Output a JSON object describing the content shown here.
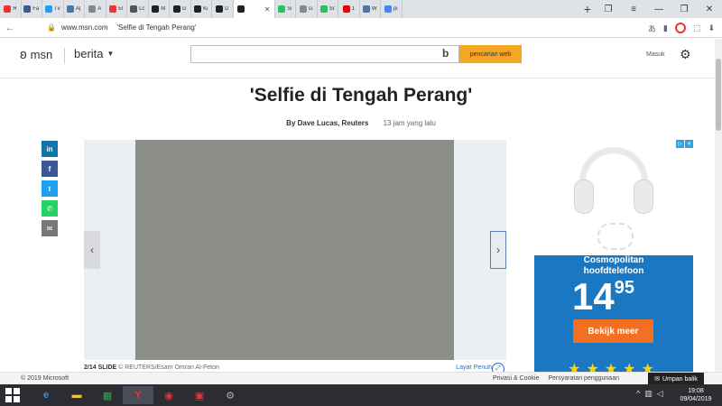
{
  "browser": {
    "tabs": [
      {
        "label": "Я",
        "color": "#e33"
      },
      {
        "label": "Fa",
        "color": "#3b5998"
      },
      {
        "label": "Tv",
        "color": "#1da1f2"
      },
      {
        "label": "A|",
        "color": "#4a76a8"
      },
      {
        "label": "A",
        "color": "#888"
      },
      {
        "label": "Eł",
        "color": "#e33"
      },
      {
        "label": "Lc",
        "color": "#555"
      },
      {
        "label": "M",
        "color": "#222"
      },
      {
        "label": "G",
        "color": "#222"
      },
      {
        "label": "Ki",
        "color": "#222"
      },
      {
        "label": "D",
        "color": "#222"
      },
      {
        "label": "",
        "color": "#222",
        "active": true
      },
      {
        "label": "Si",
        "color": "#2dbe60"
      },
      {
        "label": "G",
        "color": "#888"
      },
      {
        "label": "Sr",
        "color": "#2dbe60"
      },
      {
        "label": "1",
        "color": "#e00"
      },
      {
        "label": "W",
        "color": "#4a76a8"
      },
      {
        "label": "pi",
        "color": "#4285f4"
      }
    ],
    "new_tab": "+",
    "url_domain": "www.msn.com",
    "page_title": "'Selfie di Tengah Perang'"
  },
  "header": {
    "logo": "msn",
    "section": "berita",
    "search_placeholder": "",
    "search_button": "pencarian web",
    "signin": "Masuk"
  },
  "article": {
    "title": "'Selfie di Tengah Perang'",
    "author": "By Dave Lucas, Reuters",
    "time": "13 jam yang lalu"
  },
  "gallery": {
    "count": "2/14 SLIDE",
    "credit": "© REUTERS/Esam Omran Al-Fetori",
    "fullscreen": "Layar Penuh"
  },
  "ad": {
    "line1": "Cosmopolitan",
    "line2": "hoofdtelefoon",
    "price_main": "14",
    "price_cents": "95",
    "cta": "Bekijk meer",
    "stars": "★★★★★"
  },
  "footer": {
    "copyright": "© 2019 Microsoft",
    "links": [
      "Privasi & Cookie",
      "Persyaratan penggunaan"
    ],
    "feedback": "Umpan balik"
  },
  "taskbar": {
    "time": "19:08",
    "date": "09/04/2019"
  }
}
